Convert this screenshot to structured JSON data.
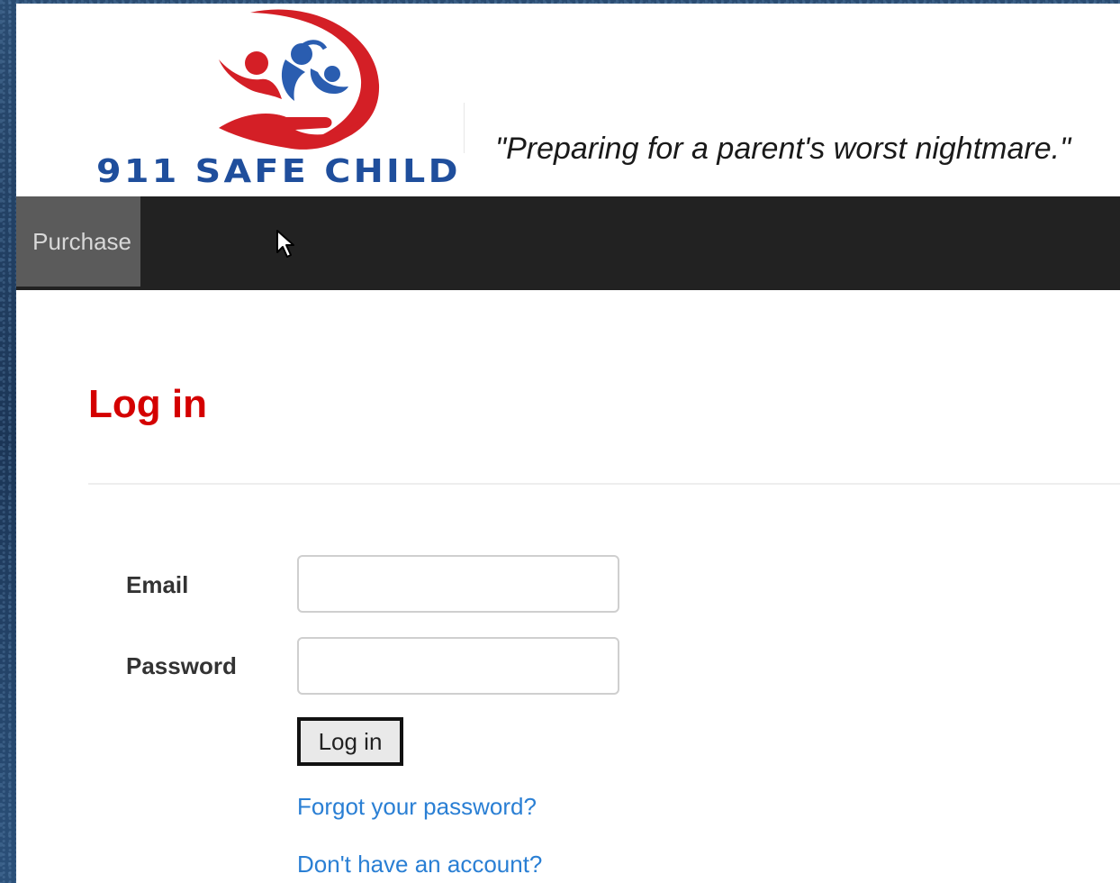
{
  "header": {
    "logo_text": "911 SAFE CHILD",
    "tagline": "\"Preparing for a parent's worst nightmare.\""
  },
  "nav": {
    "items": [
      {
        "label": "Purchase"
      }
    ]
  },
  "login": {
    "title": "Log in",
    "email_label": "Email",
    "email_value": "",
    "password_label": "Password",
    "password_value": "",
    "submit_label": "Log in",
    "forgot_link": "Forgot your password?",
    "register_link": "Don't have an account?"
  },
  "colors": {
    "brand_red": "#d40000",
    "brand_blue": "#1f4e9c",
    "link_blue": "#2a7fd4",
    "navbar": "#222222",
    "nav_active": "#5b5b5b"
  }
}
